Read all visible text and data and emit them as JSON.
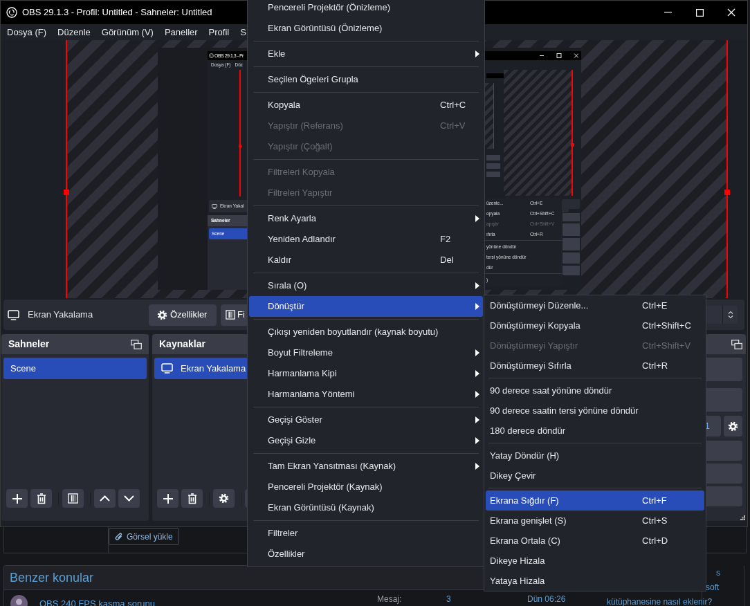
{
  "window": {
    "title": "OBS 29.1.3 - Profil: Untitled - Sahneler: Untitled"
  },
  "menu_bar": [
    "Dosya (F)",
    "Düzenle",
    "Görünüm (V)",
    "Paneller",
    "Profil",
    "S"
  ],
  "preview": {
    "captured_screen": {
      "title": "OBS 29.1.3 - Pr",
      "menu_bar": [
        "Dosya (F)",
        "Düz"
      ],
      "source_name": "Ekran Yakal",
      "scenes_title": "Sahneler",
      "scenes": [
        {
          "label": "Scene",
          "selected": true
        }
      ],
      "menu_items": [
        {
          "kind": "item",
          "label": "üzenle...",
          "shortcut": "Ctrl+E",
          "disabled": false
        },
        {
          "kind": "item",
          "label": "opyala",
          "shortcut": "Ctrl+Shift+C",
          "disabled": false
        },
        {
          "kind": "item",
          "label": "apıştır",
          "shortcut": "Ctrl+Shift+V",
          "disabled": true
        },
        {
          "kind": "item",
          "label": "ıfırla",
          "shortcut": "Ctrl+R",
          "disabled": false
        },
        {
          "kind": "separator"
        },
        {
          "kind": "item",
          "label": "yönüne döndür",
          "disabled": false
        },
        {
          "kind": "item",
          "label": "tersi yönüne döndür",
          "disabled": false
        },
        {
          "kind": "item",
          "label": "dür",
          "disabled": false
        },
        {
          "kind": "separator"
        },
        {
          "kind": "item",
          "label": ")",
          "disabled": false
        }
      ]
    }
  },
  "source_toolbar": {
    "source_name": "Ekran Yakalama",
    "buttons": [
      {
        "kind": "properties",
        "label": "Özellikler"
      },
      {
        "kind": "filters",
        "label": "Fi"
      }
    ]
  },
  "scenes_dock": {
    "title": "Sahneler",
    "items": [
      {
        "label": "Scene",
        "selected": true
      }
    ]
  },
  "sources_dock": {
    "title": "Kaynaklar",
    "items": [
      {
        "label": "Ekran Yakalama",
        "selected": true
      }
    ]
  },
  "controls_dock": {
    "field_text": "1"
  },
  "context_menu": {
    "items": [
      {
        "kind": "item",
        "label": "Pencereli Projektör (Önizleme)",
        "disabled": false,
        "submenu": false,
        "selected": false
      },
      {
        "kind": "item",
        "label": "Ekran Görüntüsü (Önizleme)",
        "disabled": false,
        "submenu": false,
        "selected": false
      },
      {
        "kind": "separator"
      },
      {
        "kind": "item",
        "label": "Ekle",
        "disabled": false,
        "submenu": true,
        "selected": false
      },
      {
        "kind": "separator"
      },
      {
        "kind": "item",
        "label": "Seçilen Ögeleri Grupla",
        "disabled": false,
        "submenu": false,
        "selected": false
      },
      {
        "kind": "separator"
      },
      {
        "kind": "item",
        "label": "Kopyala",
        "shortcut": "Ctrl+C",
        "disabled": false,
        "submenu": false,
        "selected": false
      },
      {
        "kind": "item",
        "label": "Yapıştır (Referans)",
        "shortcut": "Ctrl+V",
        "disabled": true,
        "submenu": false,
        "selected": false
      },
      {
        "kind": "item",
        "label": "Yapıştır (Çoğalt)",
        "disabled": true,
        "submenu": false,
        "selected": false
      },
      {
        "kind": "separator"
      },
      {
        "kind": "item",
        "label": "Filtreleri Kopyala",
        "disabled": true,
        "submenu": false,
        "selected": false
      },
      {
        "kind": "item",
        "label": "Filtreleri Yapıştır",
        "disabled": true,
        "submenu": false,
        "selected": false
      },
      {
        "kind": "separator"
      },
      {
        "kind": "item",
        "label": "Renk Ayarla",
        "disabled": false,
        "submenu": true,
        "selected": false
      },
      {
        "kind": "item",
        "label": "Yeniden Adlandır",
        "shortcut": "F2",
        "disabled": false,
        "submenu": false,
        "selected": false
      },
      {
        "kind": "item",
        "label": "Kaldır",
        "shortcut": "Del",
        "disabled": false,
        "submenu": false,
        "selected": false
      },
      {
        "kind": "separator"
      },
      {
        "kind": "item",
        "label": "Sırala (O)",
        "disabled": false,
        "submenu": true,
        "selected": false
      },
      {
        "kind": "item",
        "label": "Dönüştür",
        "disabled": false,
        "submenu": true,
        "selected": true
      },
      {
        "kind": "separator"
      },
      {
        "kind": "item",
        "label": "Çıkışı yeniden boyutlandır (kaynak boyutu)",
        "disabled": false,
        "submenu": false,
        "selected": false
      },
      {
        "kind": "item",
        "label": "Boyut Filtreleme",
        "disabled": false,
        "submenu": true,
        "selected": false
      },
      {
        "kind": "item",
        "label": "Harmanlama Kipi",
        "disabled": false,
        "submenu": true,
        "selected": false
      },
      {
        "kind": "item",
        "label": "Harmanlama Yöntemi",
        "disabled": false,
        "submenu": true,
        "selected": false
      },
      {
        "kind": "separator"
      },
      {
        "kind": "item",
        "label": "Geçişi Göster",
        "disabled": false,
        "submenu": true,
        "selected": false
      },
      {
        "kind": "item",
        "label": "Geçişi Gizle",
        "disabled": false,
        "submenu": true,
        "selected": false
      },
      {
        "kind": "separator"
      },
      {
        "kind": "item",
        "label": "Tam Ekran Yansıtması (Kaynak)",
        "disabled": false,
        "submenu": true,
        "selected": false
      },
      {
        "kind": "item",
        "label": "Pencereli Projektör (Kaynak)",
        "disabled": false,
        "submenu": false,
        "selected": false
      },
      {
        "kind": "item",
        "label": "Ekran Görüntüsü (Kaynak)",
        "disabled": false,
        "submenu": false,
        "selected": false
      },
      {
        "kind": "separator"
      },
      {
        "kind": "item",
        "label": "Filtreler",
        "disabled": false,
        "submenu": false,
        "selected": false
      },
      {
        "kind": "item",
        "label": "Özellikler",
        "disabled": false,
        "submenu": false,
        "selected": false
      }
    ]
  },
  "submenu": {
    "items": [
      {
        "kind": "item",
        "label": "Dönüştürmeyi Düzenle...",
        "shortcut": "Ctrl+E",
        "disabled": false,
        "selected": false
      },
      {
        "kind": "item",
        "label": "Dönüştürmeyi Kopyala",
        "shortcut": "Ctrl+Shift+C",
        "disabled": false,
        "selected": false
      },
      {
        "kind": "item",
        "label": "Dönüştürmeyi Yapıştır",
        "shortcut": "Ctrl+Shift+V",
        "disabled": true,
        "selected": false
      },
      {
        "kind": "item",
        "label": "Dönüştürmeyi Sıfırla",
        "shortcut": "Ctrl+R",
        "disabled": false,
        "selected": false
      },
      {
        "kind": "separator"
      },
      {
        "kind": "item",
        "label": "90 derece saat yönüne döndür",
        "disabled": false,
        "selected": false
      },
      {
        "kind": "item",
        "label": "90 derece saatin tersi yönüne döndür",
        "disabled": false,
        "selected": false
      },
      {
        "kind": "item",
        "label": "180 derece döndür",
        "disabled": false,
        "selected": false
      },
      {
        "kind": "separator"
      },
      {
        "kind": "item",
        "label": "Yatay Döndür (H)",
        "disabled": false,
        "selected": false
      },
      {
        "kind": "item",
        "label": "Dikey Çevir",
        "disabled": false,
        "selected": false
      },
      {
        "kind": "separator"
      },
      {
        "kind": "item",
        "label": "Ekrana Sığdır (F)",
        "shortcut": "Ctrl+F",
        "disabled": false,
        "selected": true
      },
      {
        "kind": "item",
        "label": "Ekrana genişlet (S)",
        "shortcut": "Ctrl+S",
        "disabled": false,
        "selected": false
      },
      {
        "kind": "item",
        "label": "Ekrana Ortala (C)",
        "shortcut": "Ctrl+D",
        "disabled": false,
        "selected": false
      },
      {
        "kind": "item",
        "label": "Dikeye Hizala",
        "disabled": false,
        "selected": false
      },
      {
        "kind": "item",
        "label": "Yataya Hizala",
        "disabled": false,
        "selected": false
      }
    ]
  },
  "web_page": {
    "upload_button": "Görsel yükle",
    "similar_threads": {
      "title": "Benzer konular",
      "rows": [
        {
          "title": "OBS 240 FPS kasma sorunu",
          "replies_label": "Mesaj:",
          "replies": "3",
          "date": "Dün 06:26"
        }
      ]
    },
    "sidebar_fragments": [
      "s",
      "soft",
      "kütüphanesine nasıl eklenir?"
    ]
  }
}
